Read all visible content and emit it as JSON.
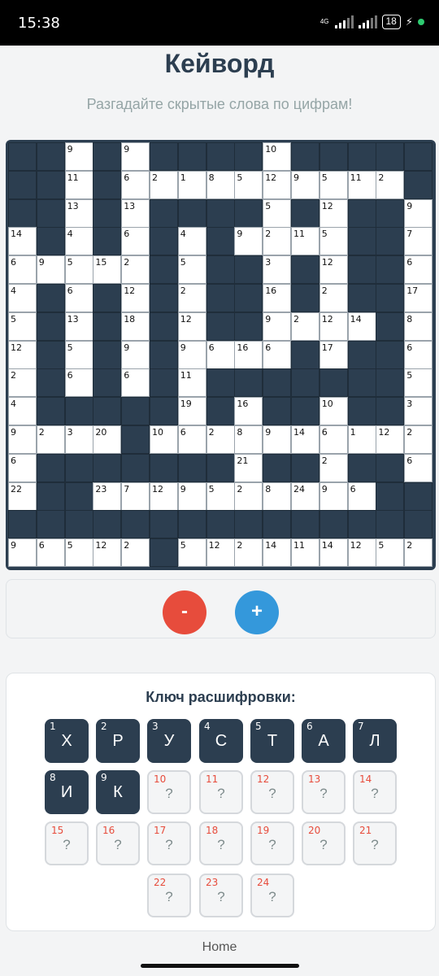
{
  "status": {
    "time": "15:38",
    "network": "4G",
    "battery": "18"
  },
  "header": {
    "title": "Кейворд",
    "subtitle": "Разгадайте скрытые слова по цифрам!"
  },
  "grid": {
    "size": 15,
    "rows": [
      "X X 9 X 9 X X X X 10 X X X X X",
      "X X 11 X 6 2 1 8 5 12 9 5 11 2 X",
      "X X 13 X 13 X X X X 5 X 12 X X 9",
      "14 X 4 X 6 X 4 X 9 2 11 5 X X 7",
      "6 9 5 15 2 X 5 X X 3 X 12 X X 6",
      "4 X 6 X 12 X 2 X X 16 X 2 X X 17",
      "5 X 13 X 18 X 12 X X 9 2 12 14 X 8",
      "12 X 5 X 9 X 9 6 16 6 X 17 X X 6",
      "2 X 6 X 6 X 11 X X X X X X X 5",
      "4 X X X X X 19 X 16 X X 10 X X 3",
      "9 2 3 20 X 10 6 2 8 9 14 6 1 12 2",
      "6 X X X X X X X 21 X X 2 X X 6",
      "22 X X 23 7 12 9 5 2 8 24 9 6 X X",
      "X X X X X X X X X X X X X X X",
      "9 6 5 12 2 X 5 12 2 14 11 14 12 5 2"
    ]
  },
  "controls": {
    "minus_label": "-",
    "plus_label": "+"
  },
  "key": {
    "title": "Ключ расшифровки:",
    "items": [
      {
        "num": "1",
        "letter": "Х",
        "solved": true
      },
      {
        "num": "2",
        "letter": "Р",
        "solved": true
      },
      {
        "num": "3",
        "letter": "У",
        "solved": true
      },
      {
        "num": "4",
        "letter": "С",
        "solved": true
      },
      {
        "num": "5",
        "letter": "Т",
        "solved": true
      },
      {
        "num": "6",
        "letter": "А",
        "solved": true
      },
      {
        "num": "7",
        "letter": "Л",
        "solved": true
      },
      {
        "num": "8",
        "letter": "И",
        "solved": true
      },
      {
        "num": "9",
        "letter": "К",
        "solved": true
      },
      {
        "num": "10",
        "letter": "?",
        "solved": false
      },
      {
        "num": "11",
        "letter": "?",
        "solved": false
      },
      {
        "num": "12",
        "letter": "?",
        "solved": false
      },
      {
        "num": "13",
        "letter": "?",
        "solved": false
      },
      {
        "num": "14",
        "letter": "?",
        "solved": false
      },
      {
        "num": "15",
        "letter": "?",
        "solved": false
      },
      {
        "num": "16",
        "letter": "?",
        "solved": false
      },
      {
        "num": "17",
        "letter": "?",
        "solved": false
      },
      {
        "num": "18",
        "letter": "?",
        "solved": false
      },
      {
        "num": "19",
        "letter": "?",
        "solved": false
      },
      {
        "num": "20",
        "letter": "?",
        "solved": false
      },
      {
        "num": "21",
        "letter": "?",
        "solved": false
      },
      {
        "num": "22",
        "letter": "?",
        "solved": false
      },
      {
        "num": "23",
        "letter": "?",
        "solved": false
      },
      {
        "num": "24",
        "letter": "?",
        "solved": false
      }
    ]
  },
  "nav": {
    "home_label": "Home"
  }
}
